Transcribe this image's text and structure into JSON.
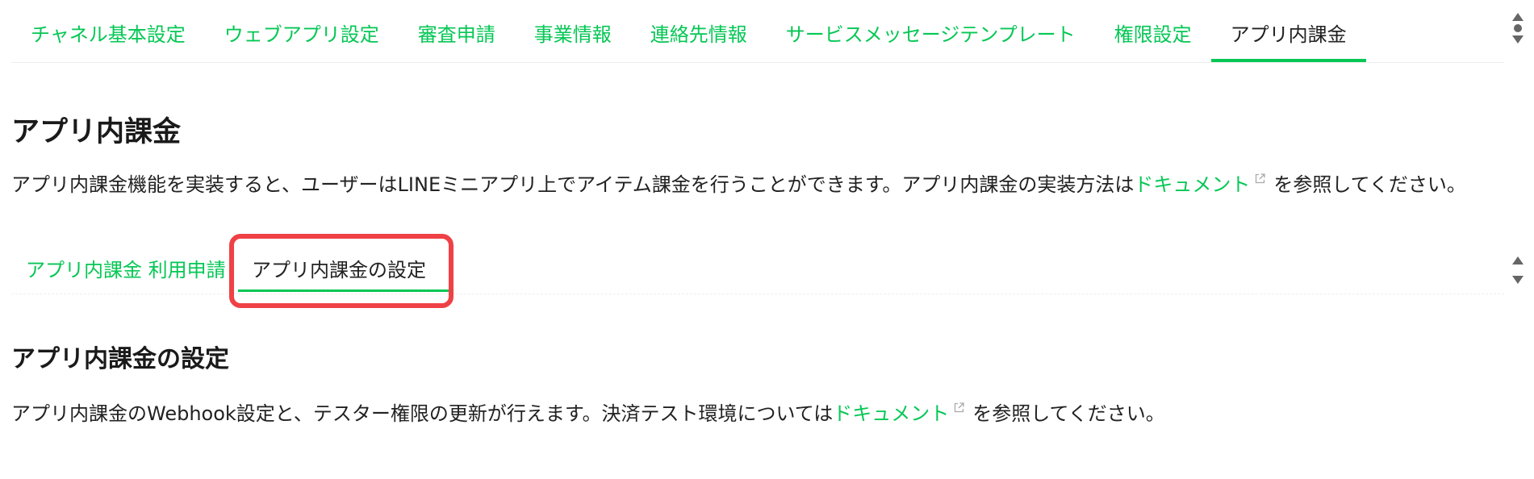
{
  "top_tabs": [
    {
      "label": "チャネル基本設定",
      "active": false
    },
    {
      "label": "ウェブアプリ設定",
      "active": false
    },
    {
      "label": "審査申請",
      "active": false
    },
    {
      "label": "事業情報",
      "active": false
    },
    {
      "label": "連絡先情報",
      "active": false
    },
    {
      "label": "サービスメッセージテンプレート",
      "active": false
    },
    {
      "label": "権限設定",
      "active": false
    },
    {
      "label": "アプリ内課金",
      "active": true
    }
  ],
  "page_title": "アプリ内課金",
  "intro": {
    "before": "アプリ内課金機能を実装すると、ユーザーはLINEミニアプリ上でアイテム課金を行うことができます。アプリ内課金の実装方法は",
    "link": "ドキュメント",
    "after": "を参照してください。"
  },
  "sub_tabs": {
    "application": "アプリ内課金 利用申請",
    "settings": "アプリ内課金の設定"
  },
  "section": {
    "title": "アプリ内課金の設定",
    "before": "アプリ内課金のWebhook設定と、テスター権限の更新が行えます。決済テスト環境については",
    "link": "ドキュメント",
    "after": "を参照してください。"
  },
  "colors": {
    "accent": "#06c755",
    "highlight": "#ef4146",
    "text": "#222222"
  },
  "icons": [
    "external-link-icon",
    "scroll-up-icon",
    "scroll-down-icon"
  ]
}
